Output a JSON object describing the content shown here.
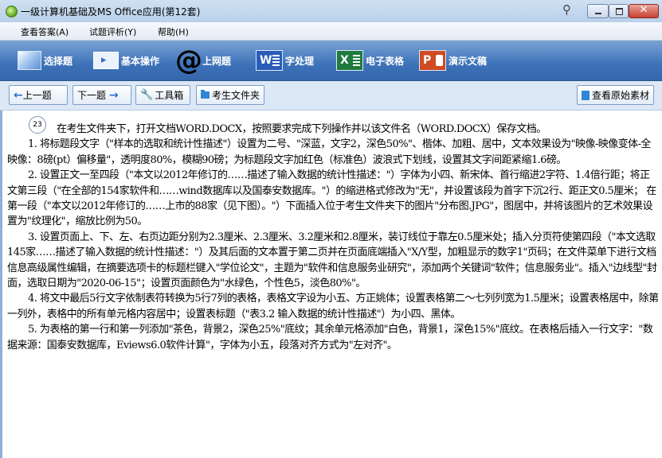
{
  "window": {
    "title": "一级计算机基础及MS Office应用(第12套)",
    "pin_glyph": "⚲",
    "close_glyph": "✕"
  },
  "menu": [
    "查看答案(A)",
    "试题评析(Y)",
    "帮助(H)"
  ],
  "toolbar": {
    "items": [
      {
        "label": "选择题",
        "icon": "select-icon"
      },
      {
        "label": "基本操作",
        "icon": "basic-ops-icon"
      },
      {
        "label": "上网题",
        "icon": "at-icon",
        "glyph": "@"
      },
      {
        "label": "字处理",
        "icon": "word-icon",
        "glyph": "W"
      },
      {
        "label": "电子表格",
        "icon": "excel-icon",
        "glyph": "X"
      },
      {
        "label": "演示文稿",
        "icon": "ppt-icon",
        "glyph": "P"
      }
    ]
  },
  "nav": {
    "prev": "上一题",
    "next": "下一题",
    "toolbox": "工具箱",
    "student_folder": "考生文件夹",
    "view_material": "查看原始素材",
    "prev_arrow": "←",
    "next_arrow": "→",
    "wrench_glyph": "🔧"
  },
  "question": {
    "number": "23",
    "paragraphs": [
      "在考生文件夹下，打开文档WORD.DOCX，按照要求完成下列操作并以该文件名（WORD.DOCX）保存文档。",
      "1. 将标题段文字（\"样本的选取和统计性描述\"）设置为二号、\"深蓝，文字2，深色50%\"、楷体、加粗、居中，文本效果设为\"映像-映像变体-全映像：8磅(pt）偏移量\"，透明度80%，模糊90磅；为标题段文字加红色（标准色）波浪式下划线，设置其文字间距紧缩1.6磅。",
      "2. 设置正文一至四段（\"本文以2012年修订的……描述了输入数据的统计性描述：\"）字体为小四、新宋体、首行缩进2字符、1.4倍行距；将正文第三段（\"在全部的154家软件和……wind数据库以及国泰安数据库。\"）的缩进格式修改为\"无\"，并设置该段为首字下沉2行、距正文0.5厘米；  在第一段（\"本文以2012年修订的……上市的88家（见下图）。\"）下面插入位于考生文件夹下的图片\"分布图.JPG\"，图居中，并将该图片的艺术效果设置为\"纹理化\"，缩放比例为50。",
      "3. 设置页面上、下、左、右页边距分别为2.3厘米、2.3厘米、3.2厘米和2.8厘米，装订线位于靠左0.5厘米处；插入分页符使第四段（\"本文选取145家……描述了输入数据的统计性描述：\"）及其后面的文本置于第二页并在页面底端插入\"X/Y型，加粗显示的数字1\"页码；在文件菜单下进行文档信息高级属性编辑，在摘要选项卡的标题栏键入\"学位论文\"，主题为\"软件和信息服务业研究\"，添加两个关键词\"软件；信息服务业\"。插入\"边线型\"封面，选取日期为\"2020-06-15\"；设置页面颜色为\"水绿色，个性色5，淡色80%\"。",
      "4. 将文中最后5行文字依制表符转换为5行7列的表格，表格文字设为小五、方正姚体；设置表格第二～七列列宽为1.5厘米；设置表格居中，除第一列外，表格中的所有单元格内容居中；设置表标题（\"表3.2 输入数据的统计性描述\"）为小四、黑体。",
      "5. 为表格的第一行和第一列添加\"茶色，背景2，深色25%\"底纹；其余单元格添加\"白色，背景1，深色15%\"底纹。在表格后插入一行文字：\"数据来源：国泰安数据库，Eviews6.0软件计算\"，字体为小五，段落对齐方式为\"左对齐\"。"
    ]
  }
}
